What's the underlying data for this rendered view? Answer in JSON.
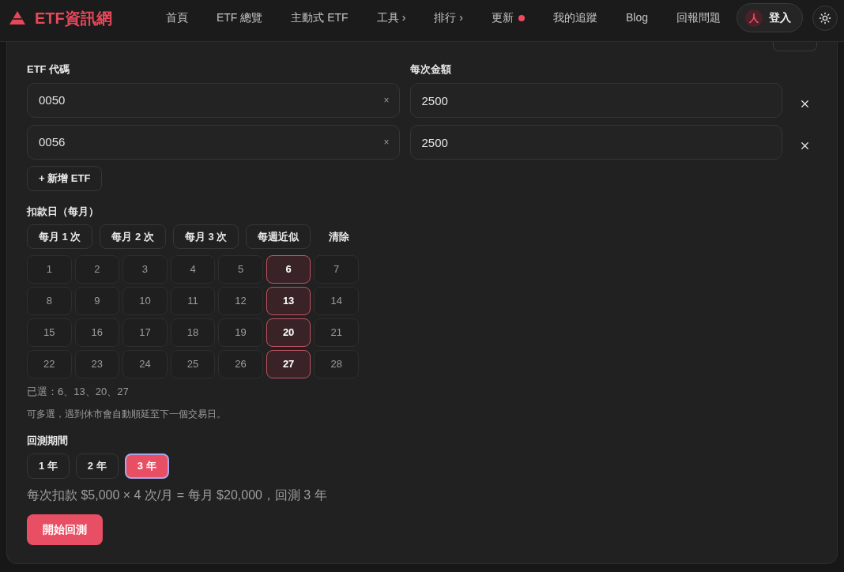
{
  "header": {
    "logo": "ETF資訊網",
    "nav": [
      {
        "label": "首頁",
        "kind": "link"
      },
      {
        "label": "ETF 總覽",
        "kind": "link"
      },
      {
        "label": "主動式 ETF",
        "kind": "link"
      },
      {
        "label": "工具",
        "kind": "menu",
        "caret": "›"
      },
      {
        "label": "排行",
        "kind": "menu",
        "caret": "›"
      },
      {
        "label": "更新",
        "kind": "dot"
      },
      {
        "label": "我的追蹤",
        "kind": "link"
      },
      {
        "label": "Blog",
        "kind": "link"
      },
      {
        "label": "回報問題",
        "kind": "link"
      }
    ],
    "login": "登入"
  },
  "form": {
    "code_label": "ETF 代碼",
    "amount_label": "每次金額",
    "holdings": [
      {
        "code": "0050",
        "clear": "×",
        "amount": "2500"
      },
      {
        "code": "0056",
        "clear": "×",
        "amount": "2500"
      }
    ],
    "add_button": "+ 新增 ETF",
    "debit_day_label": "扣款日（每月）",
    "presets": [
      {
        "label": "每月 1 次",
        "kind": "outline"
      },
      {
        "label": "每月 2 次",
        "kind": "outline"
      },
      {
        "label": "每月 3 次",
        "kind": "outline"
      },
      {
        "label": "每週近似",
        "kind": "outline"
      },
      {
        "label": "清除",
        "kind": "text"
      }
    ],
    "days": [
      {
        "label": "1",
        "selected": false
      },
      {
        "label": "2",
        "selected": false
      },
      {
        "label": "3",
        "selected": false
      },
      {
        "label": "4",
        "selected": false
      },
      {
        "label": "5",
        "selected": false
      },
      {
        "label": "6",
        "selected": true
      },
      {
        "label": "7",
        "selected": false
      },
      {
        "label": "8",
        "selected": false
      },
      {
        "label": "9",
        "selected": false
      },
      {
        "label": "10",
        "selected": false
      },
      {
        "label": "11",
        "selected": false
      },
      {
        "label": "12",
        "selected": false
      },
      {
        "label": "13",
        "selected": true
      },
      {
        "label": "14",
        "selected": false
      },
      {
        "label": "15",
        "selected": false
      },
      {
        "label": "16",
        "selected": false
      },
      {
        "label": "17",
        "selected": false
      },
      {
        "label": "18",
        "selected": false
      },
      {
        "label": "19",
        "selected": false
      },
      {
        "label": "20",
        "selected": true
      },
      {
        "label": "21",
        "selected": false
      },
      {
        "label": "22",
        "selected": false
      },
      {
        "label": "23",
        "selected": false
      },
      {
        "label": "24",
        "selected": false
      },
      {
        "label": "25",
        "selected": false
      },
      {
        "label": "26",
        "selected": false
      },
      {
        "label": "27",
        "selected": true
      },
      {
        "label": "28",
        "selected": false
      }
    ],
    "selected_days": "已選：6、13、20、27",
    "hint": "可多選，遇到休市會自動順延至下一個交易日。",
    "period_label": "回測期間",
    "periods": [
      {
        "label": "1 年",
        "selected": false
      },
      {
        "label": "2 年",
        "selected": false
      },
      {
        "label": "3 年",
        "selected": true
      }
    ],
    "summary": "每次扣款 $5,000 × 4 次/月 = 每月 $20,000，回測 3 年",
    "start_button": "開始回測"
  }
}
